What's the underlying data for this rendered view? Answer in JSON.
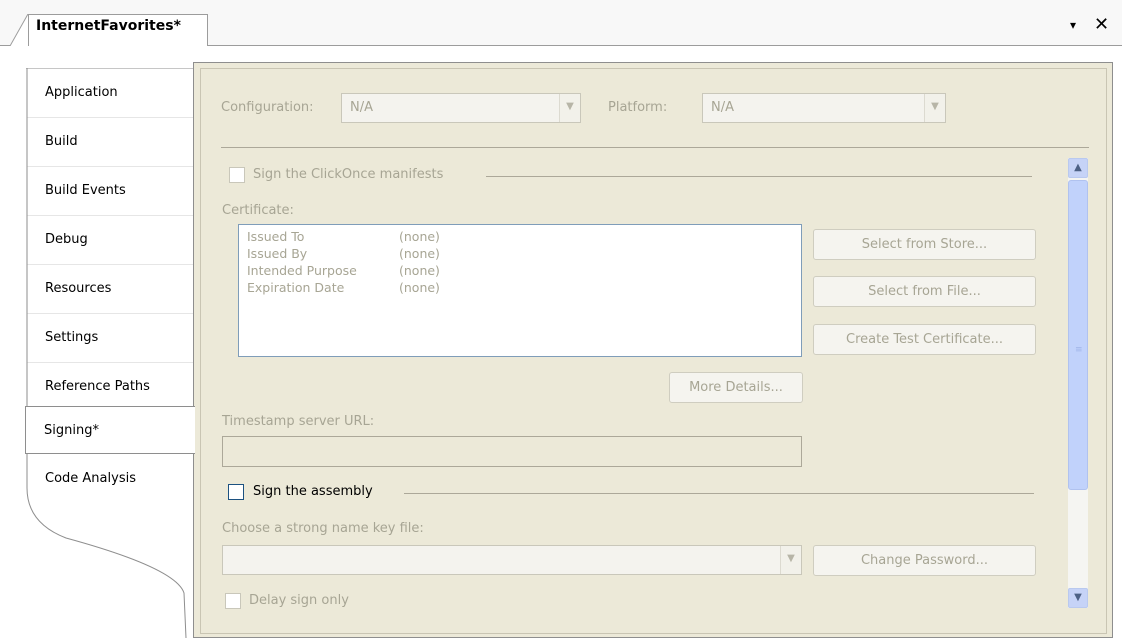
{
  "document_tab": {
    "title": "InternetFavorites*"
  },
  "window_controls": {
    "dropdown_glyph": "▾",
    "close_glyph": "✕"
  },
  "side_tabs": [
    {
      "label": "Application"
    },
    {
      "label": "Build"
    },
    {
      "label": "Build Events"
    },
    {
      "label": "Debug"
    },
    {
      "label": "Resources"
    },
    {
      "label": "Settings"
    },
    {
      "label": "Reference Paths"
    },
    {
      "label": "Signing*"
    },
    {
      "label": "Code Analysis"
    }
  ],
  "selected_tab": "Signing*",
  "configuration": {
    "label": "Configuration:",
    "value": "N/A"
  },
  "platform": {
    "label": "Platform:",
    "value": "N/A"
  },
  "clickonce": {
    "label": "Sign the ClickOnce manifests",
    "checked": false
  },
  "certificate": {
    "label": "Certificate:",
    "rows": [
      {
        "key": "Issued To",
        "value": "(none)"
      },
      {
        "key": "Issued By",
        "value": "(none)"
      },
      {
        "key": "Intended Purpose",
        "value": "(none)"
      },
      {
        "key": "Expiration Date",
        "value": "(none)"
      }
    ]
  },
  "buttons": {
    "select_store": "Select from Store...",
    "select_file": "Select from File...",
    "create_test": "Create Test Certificate...",
    "more_details": "More Details...",
    "change_password": "Change Password..."
  },
  "timestamp": {
    "label": "Timestamp server URL:",
    "value": ""
  },
  "sign_assembly": {
    "label": "Sign the assembly",
    "checked": false
  },
  "strong_name": {
    "label": "Choose a strong name key file:",
    "value": ""
  },
  "delay_sign": {
    "label": "Delay sign only",
    "checked": false
  }
}
